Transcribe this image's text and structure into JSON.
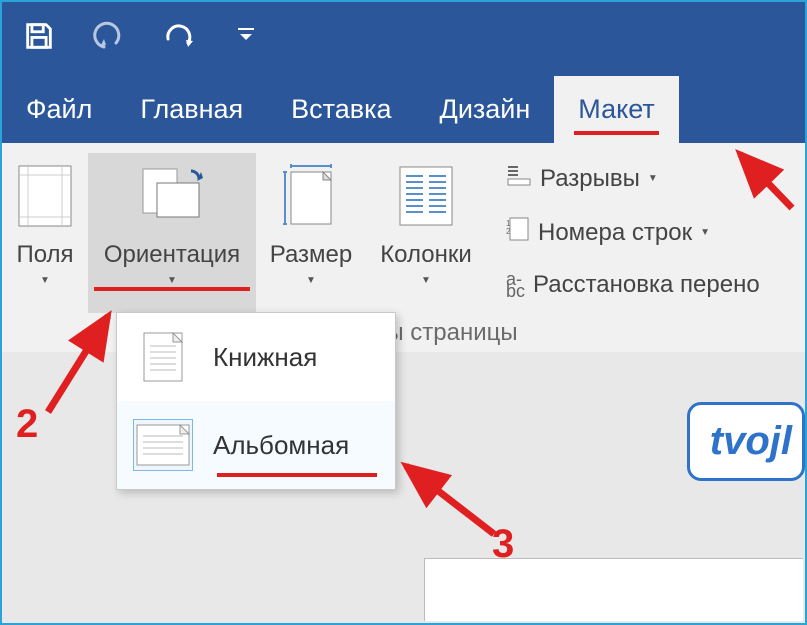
{
  "titlebar": {
    "save": "save",
    "undo": "undo",
    "redo": "redo",
    "customize": "customize"
  },
  "tabs": {
    "file": "Файл",
    "home": "Главная",
    "insert": "Вставка",
    "design": "Дизайн",
    "layout": "Макет"
  },
  "ribbon": {
    "margins": "Поля",
    "orientation": "Ориентация",
    "size": "Размер",
    "columns": "Колонки",
    "breaks": "Разрывы",
    "line_numbers": "Номера строк",
    "hyphenation": "Расстановка перено",
    "group_caption": "тры страницы"
  },
  "orientation_menu": {
    "portrait": "Книжная",
    "landscape": "Альбомная"
  },
  "annotations": {
    "n2": "2",
    "n3": "3"
  },
  "watermark": "tvojl",
  "colors": {
    "brand": "#2b579a",
    "red": "#e02020",
    "border": "#2aa3d9"
  }
}
